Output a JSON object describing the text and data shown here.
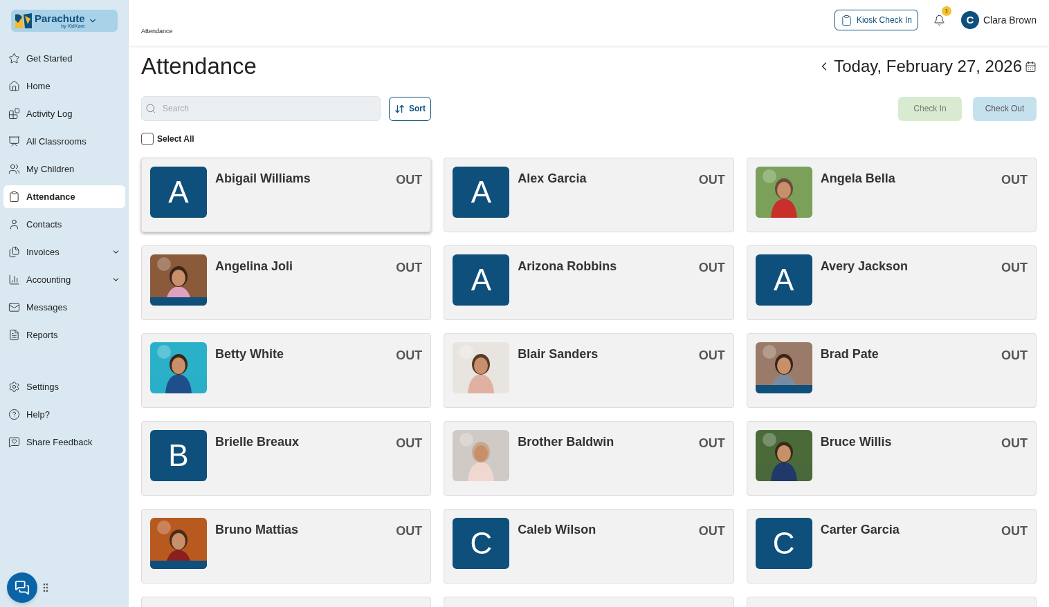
{
  "logo": {
    "name": "Parachute",
    "tagline": "by KidKare"
  },
  "sidebar": {
    "items": [
      {
        "label": "Get Started",
        "selected": false,
        "expandable": false
      },
      {
        "label": "Home",
        "selected": false,
        "expandable": false
      },
      {
        "label": "Activity Log",
        "selected": false,
        "expandable": false
      },
      {
        "label": "All Classrooms",
        "selected": false,
        "expandable": false
      },
      {
        "label": "My Children",
        "selected": false,
        "expandable": false
      },
      {
        "label": "Attendance",
        "selected": true,
        "expandable": false
      },
      {
        "label": "Contacts",
        "selected": false,
        "expandable": false
      },
      {
        "label": "Invoices",
        "selected": false,
        "expandable": true
      },
      {
        "label": "Accounting",
        "selected": false,
        "expandable": true
      },
      {
        "label": "Messages",
        "selected": false,
        "expandable": false
      },
      {
        "label": "Reports",
        "selected": false,
        "expandable": false
      }
    ],
    "footer_items": [
      {
        "label": "Settings"
      },
      {
        "label": "Help?"
      },
      {
        "label": "Share Feedback"
      }
    ]
  },
  "header": {
    "breadcrumb": "Attendance",
    "kiosk_button": "Kiosk Check In",
    "notification_count": "1",
    "user": {
      "initial": "C",
      "name": "Clara Brown"
    }
  },
  "page": {
    "title": "Attendance",
    "date": "Today, February 27, 2026",
    "search": {
      "placeholder": "Search"
    },
    "sort_button": "Sort",
    "check_in_button": "Check In",
    "check_out_button": "Check Out",
    "select_all": {
      "label": "Select All",
      "checked": false
    }
  },
  "children": [
    {
      "name": "Abigail Williams",
      "status": "OUT",
      "kind": "initial",
      "initial": "A",
      "hovered": true
    },
    {
      "name": "Alex Garcia",
      "status": "OUT",
      "kind": "initial",
      "initial": "A",
      "hovered": false
    },
    {
      "name": "Angela Bella",
      "status": "OUT",
      "hovered": false
    },
    {
      "name": "Angelina Joli",
      "status": "OUT",
      "hovered": false
    },
    {
      "name": "Arizona Robbins",
      "status": "OUT",
      "kind": "initial",
      "initial": "A",
      "hovered": false
    },
    {
      "name": "Avery Jackson",
      "status": "OUT",
      "kind": "initial",
      "initial": "A",
      "hovered": false
    },
    {
      "name": "Betty White",
      "status": "OUT",
      "hovered": false
    },
    {
      "name": "Blair Sanders",
      "status": "OUT",
      "hovered": false
    },
    {
      "name": "Brad Pate",
      "status": "OUT",
      "hovered": false
    },
    {
      "name": "Brielle Breaux",
      "status": "OUT",
      "kind": "initial",
      "initial": "B",
      "hovered": false
    },
    {
      "name": "Brother Baldwin",
      "status": "OUT",
      "hovered": false
    },
    {
      "name": "Bruce Willis",
      "status": "OUT",
      "hovered": false
    },
    {
      "name": "Bruno Mattias",
      "status": "OUT",
      "hovered": false
    },
    {
      "name": "Caleb Wilson",
      "status": "OUT",
      "kind": "initial",
      "initial": "C",
      "hovered": false
    },
    {
      "name": "Carter Garcia",
      "status": "OUT",
      "kind": "initial",
      "initial": "C",
      "hovered": false
    }
  ]
}
